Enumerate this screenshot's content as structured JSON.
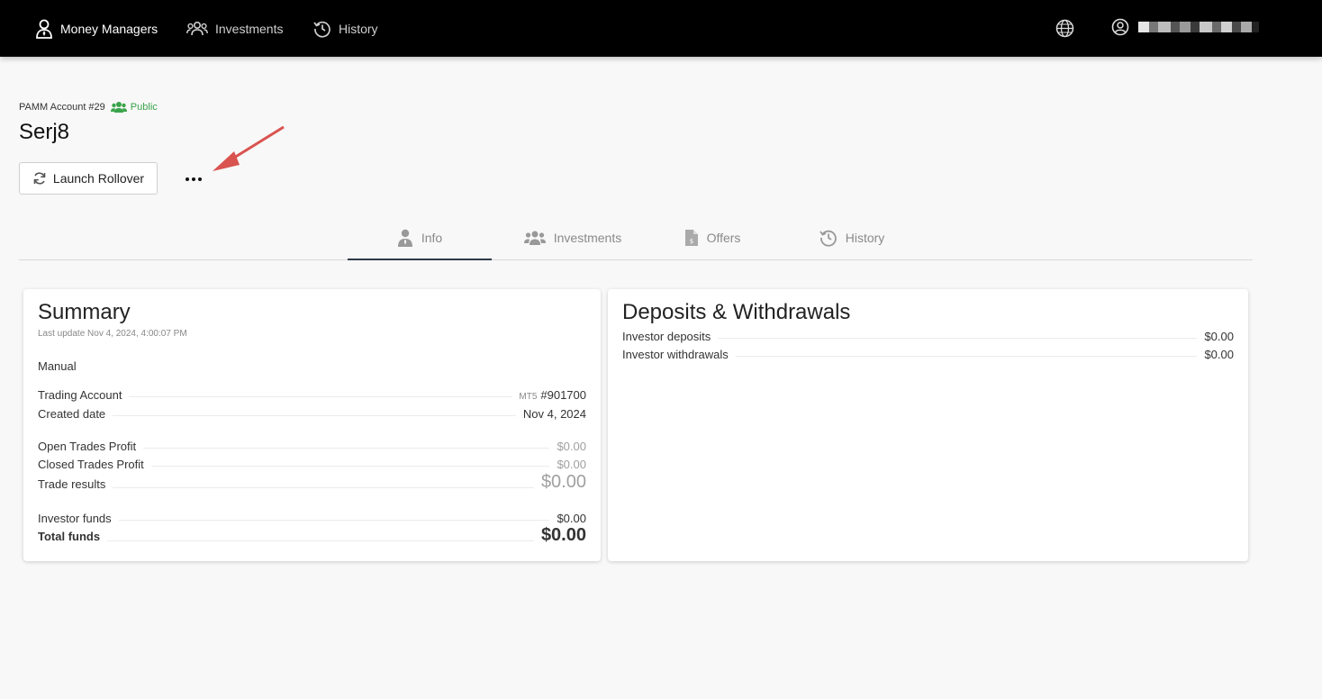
{
  "nav": {
    "money_managers": "Money Managers",
    "investments": "Investments",
    "history": "History"
  },
  "account": {
    "label": "PAMM Account #29",
    "visibility": "Public",
    "name": "Serj8"
  },
  "actions": {
    "launch_rollover": "Launch Rollover"
  },
  "tabs": [
    {
      "label": "Info",
      "icon": "user-tie-icon",
      "active": true
    },
    {
      "label": "Investments",
      "icon": "users-icon",
      "active": false
    },
    {
      "label": "Offers",
      "icon": "document-dollar-icon",
      "active": false
    },
    {
      "label": "History",
      "icon": "history-icon",
      "active": false
    }
  ],
  "summary": {
    "title": "Summary",
    "last_update": "Last update Nov 4, 2024, 4:00:07 PM",
    "mode": "Manual",
    "trading_account_label": "Trading Account",
    "trading_account_platform": "MT5",
    "trading_account_value": "#901700",
    "created_date_label": "Created date",
    "created_date_value": "Nov 4, 2024",
    "open_trades_label": "Open Trades Profit",
    "open_trades_value": "$0.00",
    "closed_trades_label": "Closed Trades Profit",
    "closed_trades_value": "$0.00",
    "trade_results_label": "Trade results",
    "trade_results_value": "$0.00",
    "investor_funds_label": "Investor funds",
    "investor_funds_value": "$0.00",
    "total_funds_label": "Total funds",
    "total_funds_value": "$0.00"
  },
  "deposits": {
    "title": "Deposits & Withdrawals",
    "investor_deposits_label": "Investor deposits",
    "investor_deposits_value": "$0.00",
    "investor_withdrawals_label": "Investor withdrawals",
    "investor_withdrawals_value": "$0.00"
  },
  "colors": {
    "topbar": "#000000",
    "public_green": "#3aa34a",
    "annotation_arrow": "#d9534f",
    "active_tab_underline": "#2f3a4a"
  }
}
